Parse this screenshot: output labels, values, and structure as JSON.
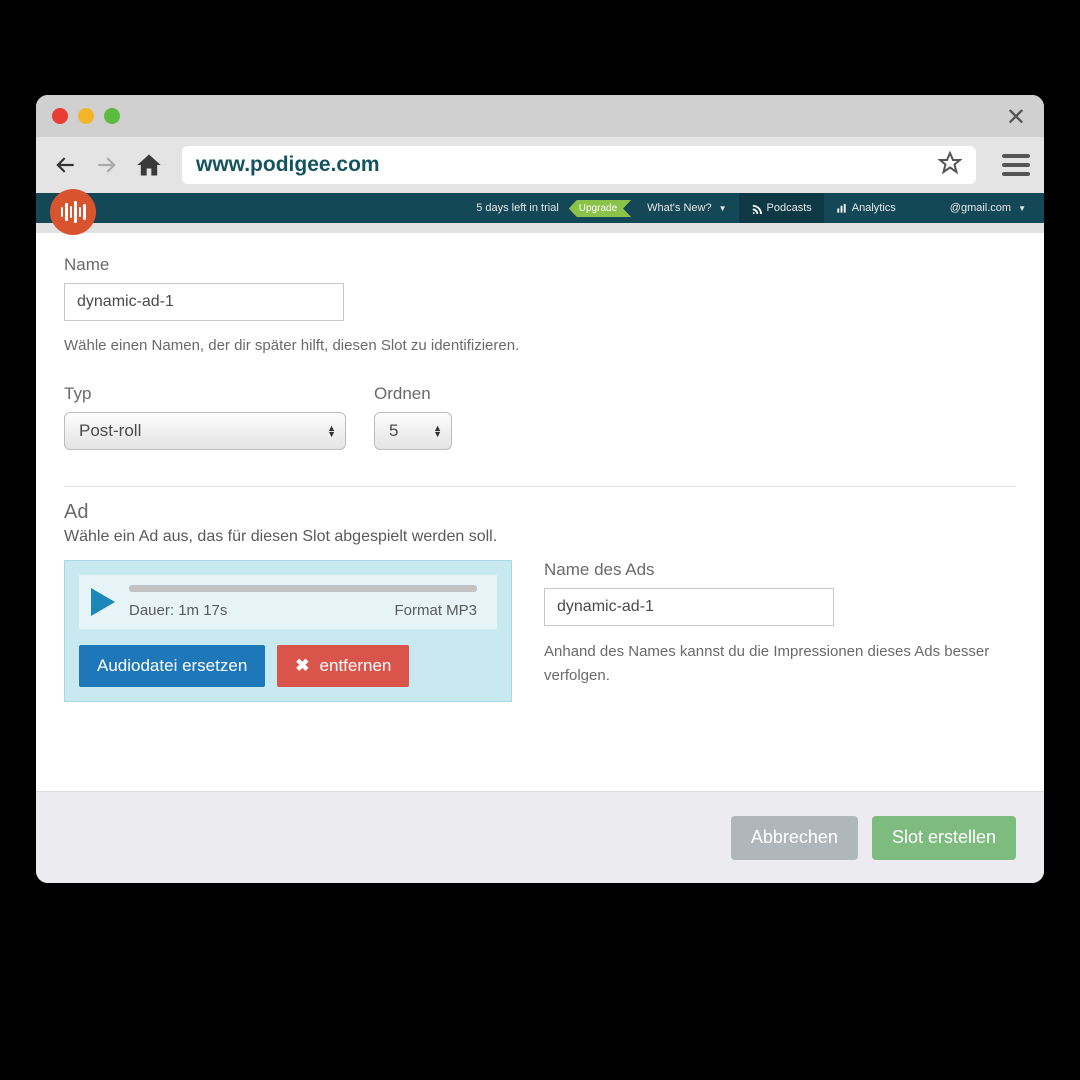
{
  "browser": {
    "url": "www.podigee.com"
  },
  "header": {
    "trial": "5 days left in trial",
    "upgrade": "Upgrade",
    "whatsnew": "What's New?",
    "podcasts": "Podcasts",
    "analytics": "Analytics",
    "account": "@gmail.com"
  },
  "form": {
    "name_label": "Name",
    "name_value": "dynamic-ad-1",
    "name_help": "Wähle einen Namen, der dir später hilft, diesen Slot zu identifizieren.",
    "typ_label": "Typ",
    "typ_value": "Post-roll",
    "ordnen_label": "Ordnen",
    "ordnen_value": "5"
  },
  "ad": {
    "title": "Ad",
    "desc": "Wähle ein Ad aus, das für diesen Slot abgespielt werden soll.",
    "duration_label": "Dauer: 1m 17s",
    "format_label": "Format MP3",
    "replace_btn": "Audiodatei ersetzen",
    "remove_btn": "entfernen",
    "name_label": "Name des Ads",
    "name_value": "dynamic-ad-1",
    "name_help": "Anhand des Names kannst du die Impressionen dieses Ads besser verfolgen."
  },
  "footer": {
    "cancel": "Abbrechen",
    "create": "Slot erstellen"
  },
  "colors": {
    "header_bg": "#154857",
    "logo_bg": "#d9542e",
    "upgrade": "#8bc24a",
    "player_panel": "#c9e9f0",
    "btn_blue": "#1d77b8",
    "btn_red": "#d9544b",
    "btn_create": "#7dbb7f"
  }
}
